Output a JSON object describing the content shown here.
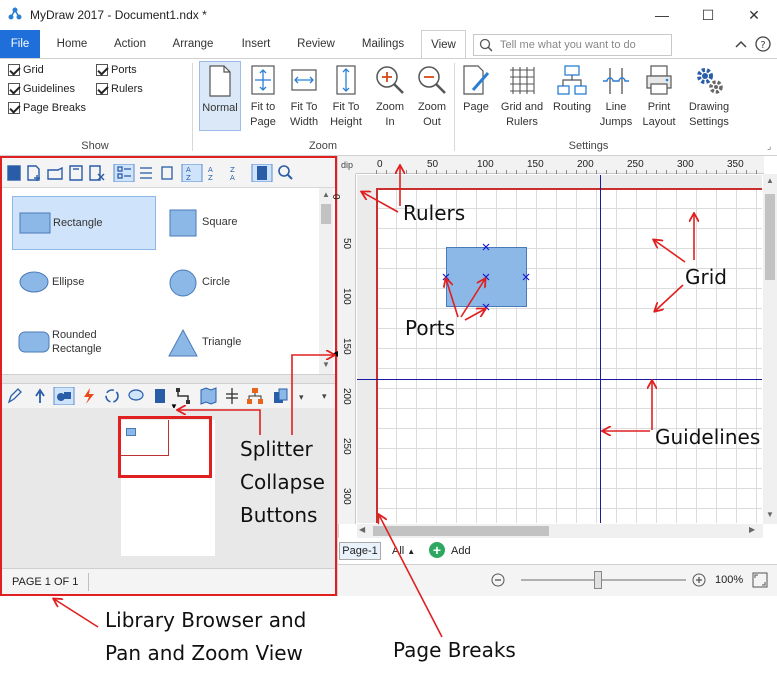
{
  "window": {
    "title": "MyDraw 2017 - Document1.ndx *",
    "minimize": "—",
    "maximize": "☐",
    "close": "✕"
  },
  "tabs": [
    "File",
    "Home",
    "Action",
    "Arrange",
    "Insert",
    "Review",
    "Mailings",
    "View"
  ],
  "active_tab": "View",
  "tellme_placeholder": "Tell me what you want to do",
  "ribbon": {
    "show": {
      "label": "Show",
      "checks": [
        {
          "label": "Grid",
          "checked": true
        },
        {
          "label": "Ports",
          "checked": true
        },
        {
          "label": "Guidelines",
          "checked": true
        },
        {
          "label": "Rulers",
          "checked": true
        },
        {
          "label": "Page Breaks",
          "checked": true
        }
      ]
    },
    "zoom": {
      "label": "Zoom",
      "buttons": [
        {
          "line1": "Normal",
          "line2": ""
        },
        {
          "line1": "Fit to",
          "line2": "Page"
        },
        {
          "line1": "Fit To",
          "line2": "Width"
        },
        {
          "line1": "Fit To",
          "line2": "Height"
        },
        {
          "line1": "Zoom",
          "line2": "In"
        },
        {
          "line1": "Zoom",
          "line2": "Out"
        }
      ]
    },
    "settings": {
      "label": "Settings",
      "buttons": [
        {
          "line1": "Page",
          "line2": ""
        },
        {
          "line1": "Grid and",
          "line2": "Rulers"
        },
        {
          "line1": "Routing",
          "line2": ""
        },
        {
          "line1": "Line",
          "line2": "Jumps"
        },
        {
          "line1": "Print",
          "line2": "Layout"
        },
        {
          "line1": "Drawing",
          "line2": "Settings"
        }
      ]
    }
  },
  "library": {
    "shapes": [
      {
        "name": "Rectangle"
      },
      {
        "name": "Square"
      },
      {
        "name": "Ellipse"
      },
      {
        "name": "Circle"
      },
      {
        "name": "Rounded\nRectangle"
      },
      {
        "name": "Triangle"
      }
    ],
    "status": "PAGE 1 OF 1"
  },
  "rulers": {
    "unit": "dip",
    "h_ticks": [
      "0",
      "50",
      "100",
      "150",
      "200",
      "250",
      "300",
      "350"
    ],
    "v_ticks": [
      "0",
      "50",
      "100",
      "150",
      "200",
      "250",
      "300"
    ]
  },
  "pages": {
    "current": "Page-1",
    "all": "All",
    "add": "Add"
  },
  "zoom_level": "100%",
  "annotations": {
    "rulers": "Rulers",
    "grid": "Grid",
    "ports": "Ports",
    "guidelines": "Guidelines",
    "splitter": [
      "Splitter",
      "Collapse",
      "Buttons"
    ],
    "library": [
      "Library Browser and",
      "Pan and Zoom View"
    ],
    "page_breaks": "Page Breaks"
  },
  "colors": {
    "accent": "#1e6fd9",
    "annotation": "#e02020",
    "shape_fill": "#8cb8e8",
    "guideline": "#1a1aa0"
  }
}
